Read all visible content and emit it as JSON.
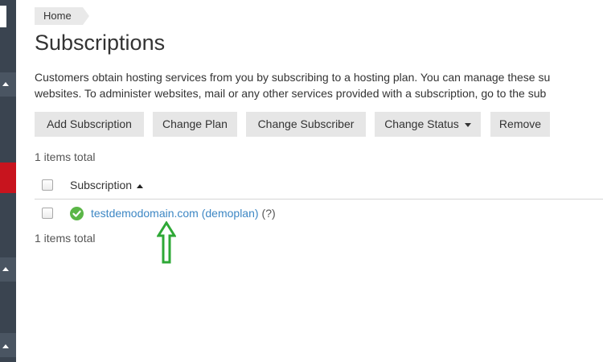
{
  "breadcrumb": {
    "home": "Home"
  },
  "page": {
    "title": "Subscriptions",
    "description_line1": "Customers obtain hosting services from you by subscribing to a hosting plan. You can manage these su",
    "description_line2": "websites. To administer websites, mail or any other services provided with a subscription, go to the sub"
  },
  "toolbar": {
    "add_subscription": "Add Subscription",
    "change_plan": "Change Plan",
    "change_subscriber": "Change Subscriber",
    "change_status": "Change Status",
    "remove": "Remove"
  },
  "list": {
    "total_top": "1 items total",
    "total_bottom": "1 items total",
    "column_header": "Subscription",
    "rows": [
      {
        "status_icon": "check-circle-icon",
        "link": "testdemodomain.com (demoplan)",
        "help": "(?)"
      }
    ]
  },
  "colors": {
    "sidebar": "#3a4450",
    "sidebar_active": "#c8141e",
    "link": "#3d87c4",
    "status_ok": "#5bb647",
    "annotation_arrow": "#2ea836"
  }
}
